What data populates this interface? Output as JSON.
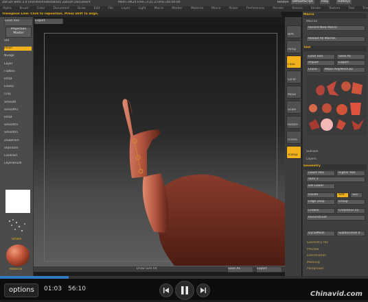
{
  "window": {
    "title": "ZBrush Beta 3.0 [marillesRnebstation] ZBrush Document",
    "title_right": "Mem=0K24 Free=3.21 ZTime=00:00:00",
    "menus_right": [
      "Hmmm",
      "DefaultScript",
      "Help",
      "Hotkeys"
    ]
  },
  "menubar": {
    "items": [
      "Alpha",
      "Brush",
      "Color",
      "Document",
      "Draw",
      "Edit",
      "File",
      "Layer",
      "Light",
      "Macro",
      "Marker",
      "Material",
      "Movie",
      "Picker",
      "Preferences",
      "Render",
      "Stencil",
      "Stroke",
      "Texture",
      "Tool",
      "Transform",
      "Zoom",
      "Zplugin",
      "Zscript"
    ]
  },
  "hint": {
    "text": "Transpose Line: Click to reposition. Press shift to align."
  },
  "leftshelf": {
    "top_buttons": [
      "Load Tool",
      "Export"
    ],
    "projection_master": "Projection Master",
    "items": [
      "Std",
      "Pinch",
      "Nudge",
      "Layer",
      "Flatten",
      "Inflat",
      "Elastic",
      "Clay",
      "Smooth",
      "Smooth5",
      "Inflat",
      "Smooth5",
      "Smooth5",
      "Zsubtract",
      "Standard",
      "Contrast",
      "LayerBrush"
    ],
    "active_index": 1,
    "stroke_label": "Stroke",
    "material_label": "Material"
  },
  "rightshelf": {
    "buttons": [
      "BPR",
      "Persp",
      "Floor",
      "Local",
      "Move",
      "Scale",
      "Rotate",
      "Frame",
      "Transp"
    ],
    "active": [
      "Floor",
      "Transp"
    ]
  },
  "viewport": {
    "bottom_label": "Draw Size 64"
  },
  "palette": {
    "macro_title": "Macro",
    "macro_label": "Macros",
    "record_new": "Record New Macro",
    "reload_all": "Reload All Macros",
    "tool_title": "Tool",
    "tool_buttons": [
      "Load Tool",
      "Save As",
      "Import",
      "Export",
      "Clone",
      "Make PolyMesh3D"
    ],
    "subtool": "SubTool",
    "layers": "Layers",
    "geometry_title": "Geometry",
    "lower_res": "Lower Res",
    "higher_res": "Higher Res",
    "sdiv": "SDiv 3",
    "del_lower": "Del Lower",
    "divide": "Divide",
    "smt": "Smt",
    "suv": "Suv",
    "edge_loop": "Edge Loop",
    "group": "Group",
    "crease": "Crease",
    "creaselvl": "CreaseLvl 15",
    "reconstruct": "Reconstruct",
    "subdiv": "SubdivLevel 0",
    "dynamesh": "DynaMesh",
    "sections": [
      "HD Geometry",
      "Preview",
      "Deformation",
      "Masking",
      "Polygroups"
    ],
    "bottom_buttons": [
      "Save As",
      "Export"
    ],
    "geometry_links": [
      "Geometry HD",
      "Preview",
      "Deformation",
      "Masking",
      "Polygroups"
    ]
  },
  "player": {
    "options_label": "options",
    "current_time": "01:03",
    "total_time": "56:10",
    "progress": 0.0187,
    "watermark": "Chinavid.com"
  }
}
